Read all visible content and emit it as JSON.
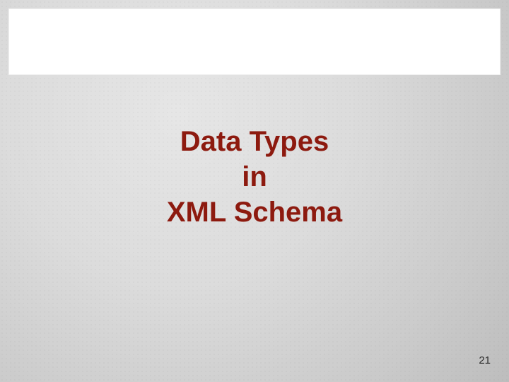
{
  "title": {
    "line1": "Data Types",
    "line2": "in",
    "line3": "XML Schema"
  },
  "page_number": "21"
}
